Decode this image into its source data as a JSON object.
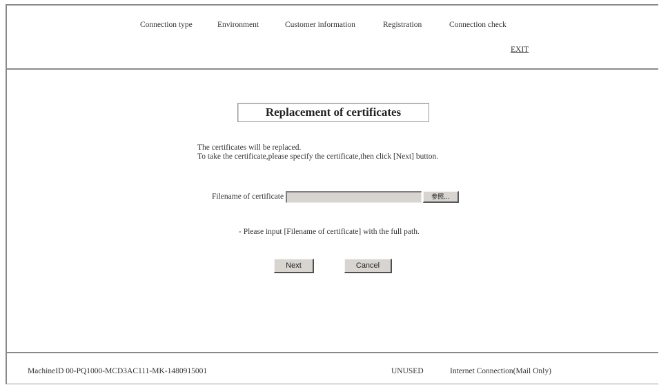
{
  "nav": {
    "items": [
      {
        "label": "Connection type"
      },
      {
        "label": "Environment"
      },
      {
        "label": "Customer information"
      },
      {
        "label": "Registration"
      },
      {
        "label": "Connection check"
      }
    ],
    "exit_label": "EXIT"
  },
  "main": {
    "title": "Replacement of certificates",
    "description_line1": "The certificates will be replaced.",
    "description_line2": "To take the certificate,please specify the certificate,then click [Next] button.",
    "file_label": "Filename of certificate",
    "file_value": "",
    "browse_label": "参照...",
    "note": "- Please input [Filename of certificate] with the full path.",
    "next_label": "Next",
    "cancel_label": "Cancel"
  },
  "footer": {
    "machine_id": "MachineID  00-PQ1000-MCD3AC111-MK-1480915001",
    "status": "UNUSED",
    "connection": "Internet Connection(Mail Only)"
  }
}
